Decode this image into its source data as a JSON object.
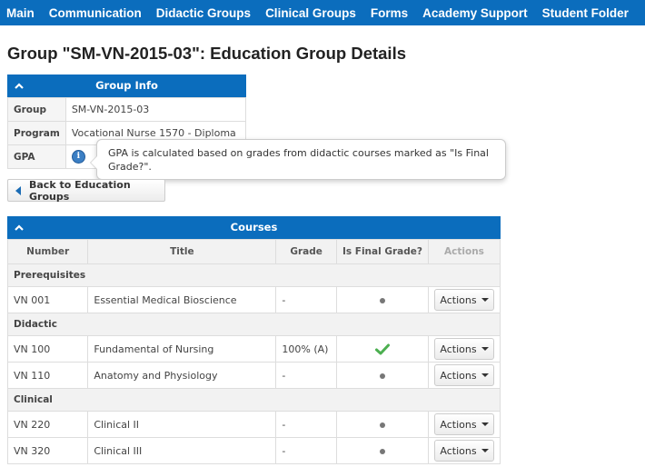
{
  "nav": {
    "items": [
      "Main",
      "Communication",
      "Didactic Groups",
      "Clinical Groups",
      "Forms",
      "Academy Support",
      "Student Folder"
    ]
  },
  "page_title": "Group \"SM-VN-2015-03\": Education Group Details",
  "group_info": {
    "heading": "Group Info",
    "rows": [
      {
        "label": "Group",
        "value": "SM-VN-2015-03"
      },
      {
        "label": "Program",
        "value": "Vocational Nurse 1570 - Diploma"
      },
      {
        "label": "GPA",
        "value": ""
      }
    ],
    "gpa_icon": "info-icon"
  },
  "tooltip": {
    "text": "GPA is calculated based on grades from didactic courses marked as \"Is Final Grade?\"."
  },
  "back_button": {
    "label": "Back to Education Groups"
  },
  "courses": {
    "heading": "Courses",
    "columns": [
      "Number",
      "Title",
      "Grade",
      "Is Final Grade?",
      "Actions"
    ],
    "sections": [
      {
        "name": "Prerequisites",
        "rows": [
          {
            "number": "VN 001",
            "title": "Essential Medical Bioscience",
            "grade": "-",
            "final": "dot",
            "action": "Actions"
          }
        ]
      },
      {
        "name": "Didactic",
        "rows": [
          {
            "number": "VN 100",
            "title": "Fundamental of Nursing",
            "grade": "100% (A)",
            "final": "check",
            "action": "Actions"
          },
          {
            "number": "VN 110",
            "title": "Anatomy and Physiology",
            "grade": "-",
            "final": "dot",
            "action": "Actions"
          }
        ]
      },
      {
        "name": "Clinical",
        "rows": [
          {
            "number": "VN 220",
            "title": "Clinical II",
            "grade": "-",
            "final": "dot",
            "action": "Actions"
          },
          {
            "number": "VN 320",
            "title": "Clinical III",
            "grade": "-",
            "final": "dot",
            "action": "Actions"
          }
        ]
      }
    ]
  },
  "colors": {
    "brand": "#0b6dbd",
    "check": "#4caf50"
  }
}
